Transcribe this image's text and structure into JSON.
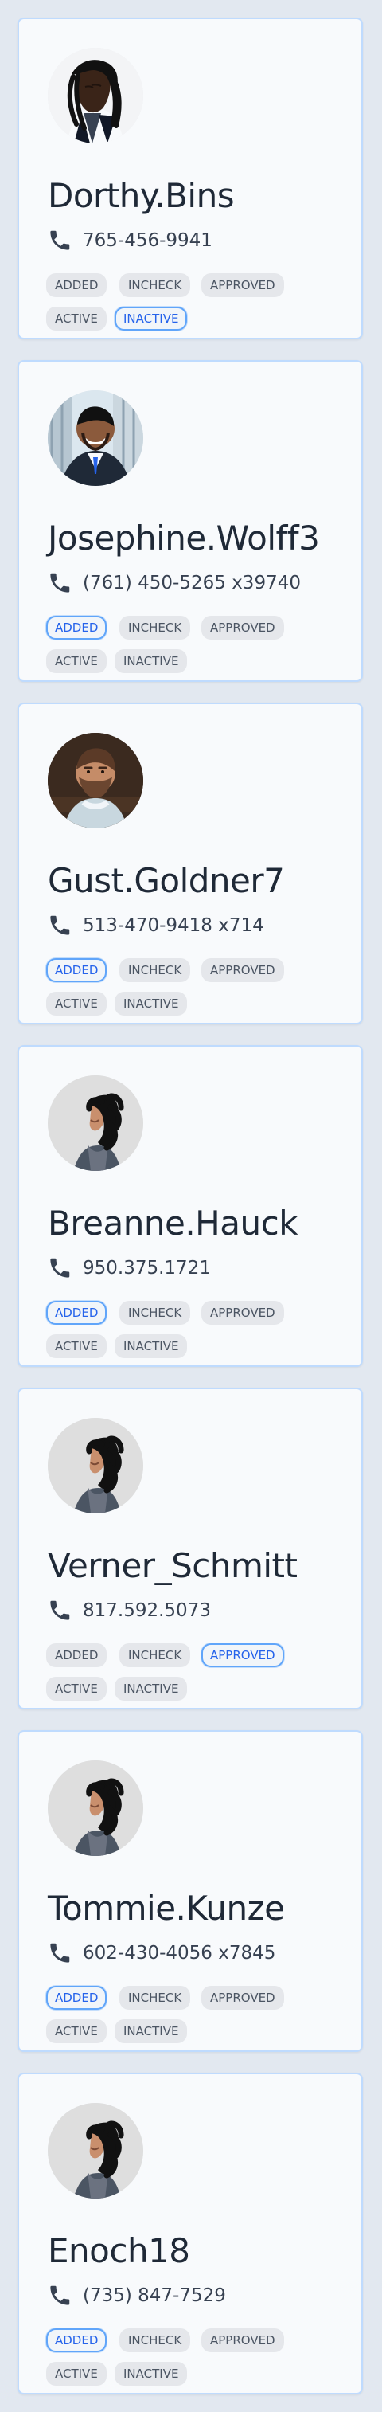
{
  "status_labels": {
    "added": "ADDED",
    "incheck": "INCHECK",
    "approved": "APPROVED",
    "active": "ACTIVE",
    "inactive": "INACTIVE"
  },
  "colors": {
    "page_background": "#e2e8f0",
    "card_background": "#f8fafc",
    "card_border": "#bfdbfe",
    "tag_background": "#e5e7eb",
    "tag_text": "#4b5563",
    "selected_border": "#60a5fa",
    "selected_text": "#2563eb",
    "name_text": "#1f2937"
  },
  "icons": {
    "phone": "phone-icon"
  },
  "contacts": [
    {
      "name": "Dorthy.Bins",
      "phone": "765-456-9941",
      "avatar": "dreadlocks",
      "selected_status": "inactive"
    },
    {
      "name": "Josephine.Wolff3",
      "phone": "(761) 450-5265 x39740",
      "avatar": "suit",
      "selected_status": "added"
    },
    {
      "name": "Gust.Goldner7",
      "phone": "513-470-9418 x714",
      "avatar": "beard",
      "selected_status": "added"
    },
    {
      "name": "Breanne.Hauck",
      "phone": "950.375.1721",
      "avatar": "profile",
      "selected_status": "added"
    },
    {
      "name": "Verner_Schmitt",
      "phone": "817.592.5073",
      "avatar": "profile",
      "selected_status": "approved"
    },
    {
      "name": "Tommie.Kunze",
      "phone": "602-430-4056 x7845",
      "avatar": "profile",
      "selected_status": "added"
    },
    {
      "name": "Enoch18",
      "phone": "(735) 847-7529",
      "avatar": "profile",
      "selected_status": "added"
    }
  ]
}
